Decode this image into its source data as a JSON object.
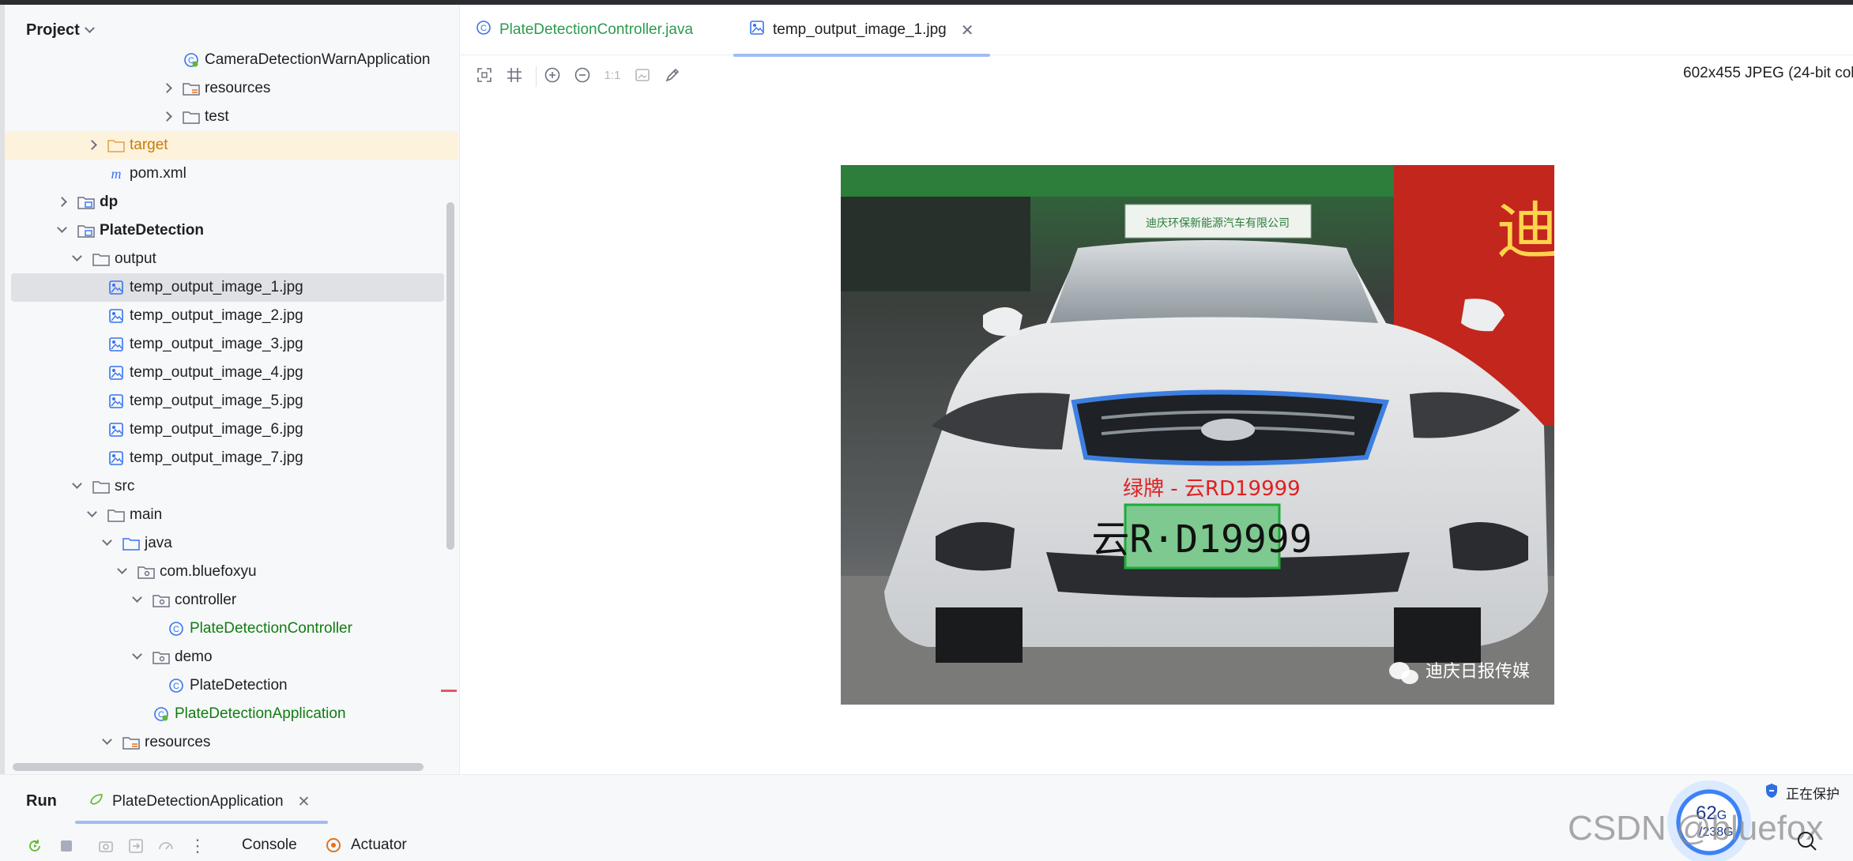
{
  "project": {
    "title": "Project",
    "tree": [
      {
        "label": "CameraDetectionWarnApplication",
        "style": "",
        "icon": "spring-class-icon",
        "arrow": ""
      },
      {
        "label": "resources",
        "style": "",
        "icon": "resources-folder-icon",
        "arrow": "right"
      },
      {
        "label": "test",
        "style": "",
        "icon": "folder-icon",
        "arrow": "right"
      },
      {
        "label": "target",
        "style": "orange",
        "icon": "orange-folder-icon",
        "arrow": "right"
      },
      {
        "label": "pom.xml",
        "style": "",
        "icon": "maven-icon",
        "arrow": ""
      },
      {
        "label": "dp",
        "style": "bold",
        "icon": "module-folder-icon",
        "arrow": "right"
      },
      {
        "label": "PlateDetection",
        "style": "bold",
        "icon": "module-folder-icon",
        "arrow": "down"
      },
      {
        "label": "output",
        "style": "",
        "icon": "folder-icon",
        "arrow": "down"
      },
      {
        "label": "temp_output_image_1.jpg",
        "style": "",
        "icon": "image-file-icon",
        "arrow": ""
      },
      {
        "label": "temp_output_image_2.jpg",
        "style": "",
        "icon": "image-file-icon",
        "arrow": ""
      },
      {
        "label": "temp_output_image_3.jpg",
        "style": "",
        "icon": "image-file-icon",
        "arrow": ""
      },
      {
        "label": "temp_output_image_4.jpg",
        "style": "",
        "icon": "image-file-icon",
        "arrow": ""
      },
      {
        "label": "temp_output_image_5.jpg",
        "style": "",
        "icon": "image-file-icon",
        "arrow": ""
      },
      {
        "label": "temp_output_image_6.jpg",
        "style": "",
        "icon": "image-file-icon",
        "arrow": ""
      },
      {
        "label": "temp_output_image_7.jpg",
        "style": "",
        "icon": "image-file-icon",
        "arrow": ""
      },
      {
        "label": "src",
        "style": "",
        "icon": "folder-icon",
        "arrow": "down"
      },
      {
        "label": "main",
        "style": "",
        "icon": "folder-icon",
        "arrow": "down"
      },
      {
        "label": "java",
        "style": "",
        "icon": "source-folder-icon",
        "arrow": "down"
      },
      {
        "label": "com.bluefoxyu",
        "style": "",
        "icon": "package-icon",
        "arrow": "down"
      },
      {
        "label": "controller",
        "style": "",
        "icon": "package-icon",
        "arrow": "down"
      },
      {
        "label": "PlateDetectionController",
        "style": "green",
        "icon": "class-icon",
        "arrow": ""
      },
      {
        "label": "demo",
        "style": "",
        "icon": "package-icon",
        "arrow": "down"
      },
      {
        "label": "PlateDetection",
        "style": "",
        "icon": "class-icon",
        "arrow": ""
      },
      {
        "label": "PlateDetectionApplication",
        "style": "green",
        "icon": "spring-class-icon",
        "arrow": ""
      },
      {
        "label": "resources",
        "style": "",
        "icon": "resources-folder-icon",
        "arrow": "down"
      }
    ],
    "selected_item": "temp_output_image_1.jpg"
  },
  "editor": {
    "tabs": [
      {
        "label": "PlateDetectionController.java",
        "icon": "class-icon",
        "active": false
      },
      {
        "label": "temp_output_image_1.jpg",
        "icon": "image-file-icon",
        "active": true
      }
    ],
    "image_info": "602x455 JPEG (24-bit col",
    "toolbar_zoom_label": "1:1",
    "image": {
      "plate_text": "云R·D19999",
      "plate_overlay_label": "绿牌 - 云RD19999",
      "roof_sign_text": "迪庆环保新能源汽车有限公司",
      "store_sign_char": "迪",
      "photo_watermark": "迪庆日报传媒"
    }
  },
  "run": {
    "title": "Run",
    "config_tab": "PlateDetectionApplication",
    "console_label": "Console",
    "actuator_label": "Actuator"
  },
  "overlay": {
    "protect_label": "正在保护",
    "gauge_value": "62",
    "gauge_unit": "G",
    "gauge_sub": "/238G",
    "watermark": "CSDN @bluefox"
  },
  "colors": {
    "accent": "#3574f0",
    "green_text": "#107c10",
    "target_orange": "#c77d0a",
    "plate_green": "#7dc98f",
    "overlay_red": "#e02020"
  }
}
